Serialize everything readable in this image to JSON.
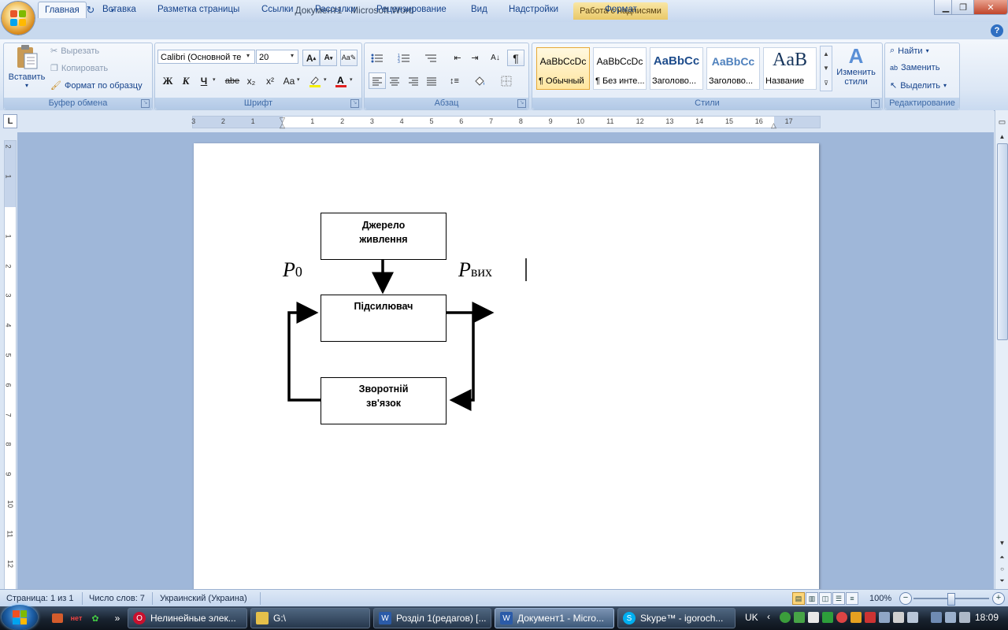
{
  "window": {
    "title": "Документ1 - Microsoft Word",
    "context_tab": "Работа с надписями"
  },
  "tabs": [
    "Главная",
    "Вставка",
    "Разметка страницы",
    "Ссылки",
    "Рассылки",
    "Рецензирование",
    "Вид",
    "Надстройки",
    "Формат"
  ],
  "ribbon": {
    "clipboard": {
      "label": "Буфер обмена",
      "paste": "Вставить",
      "cut": "Вырезать",
      "copy": "Копировать",
      "format_painter": "Формат по образцу"
    },
    "font": {
      "label": "Шрифт",
      "font_name": "Calibri (Основной те",
      "font_size": "20",
      "bold": "Ж",
      "italic": "К",
      "underline": "Ч",
      "strike": "abe",
      "subscript": "x₂",
      "superscript": "x²",
      "change_case": "Aa"
    },
    "paragraph": {
      "label": "Абзац"
    },
    "styles": {
      "label": "Стили",
      "items": [
        {
          "preview": "AaBbCcDc",
          "name": "¶ Обычный"
        },
        {
          "preview": "AaBbCcDc",
          "name": "¶ Без инте..."
        },
        {
          "preview": "AaBbCc",
          "name": "Заголово..."
        },
        {
          "preview": "AaBbCc",
          "name": "Заголово..."
        },
        {
          "preview": "AaB",
          "name": "Название"
        }
      ],
      "change_styles_1": "Изменить",
      "change_styles_2": "стили"
    },
    "editing": {
      "label": "Редактирование",
      "find": "Найти",
      "replace": "Заменить",
      "select": "Выделить"
    }
  },
  "ruler": {
    "h_numbers": [
      "3",
      "2",
      "1",
      "1",
      "2",
      "3",
      "4",
      "5",
      "6",
      "7",
      "8",
      "9",
      "10",
      "11",
      "12",
      "13",
      "14",
      "15",
      "16",
      "17"
    ],
    "v_numbers": [
      "2",
      "1",
      "1",
      "2",
      "3",
      "4",
      "5",
      "6",
      "7",
      "8",
      "9",
      "10",
      "11",
      "12"
    ]
  },
  "diagram": {
    "box_power_1": "Джерело",
    "box_power_2": "живлення",
    "box_amp": "Підсилювач",
    "box_fb_1": "Зворотній",
    "box_fb_2": "зв'язок",
    "p0_main": "P",
    "p0_sub": "0",
    "pout_main": "P",
    "pout_sub": "вих"
  },
  "statusbar": {
    "page": "Страница: 1 из 1",
    "words": "Число слов: 7",
    "language": "Украинский (Украина)",
    "zoom": "100%"
  },
  "taskbar": {
    "items": [
      "Нелинейные элек...",
      "G:\\",
      "Розділ 1(редагов) [...",
      "Документ1 - Micro...",
      "Skype™ - igoroch..."
    ],
    "lang": "UK",
    "clock": "18:09"
  }
}
